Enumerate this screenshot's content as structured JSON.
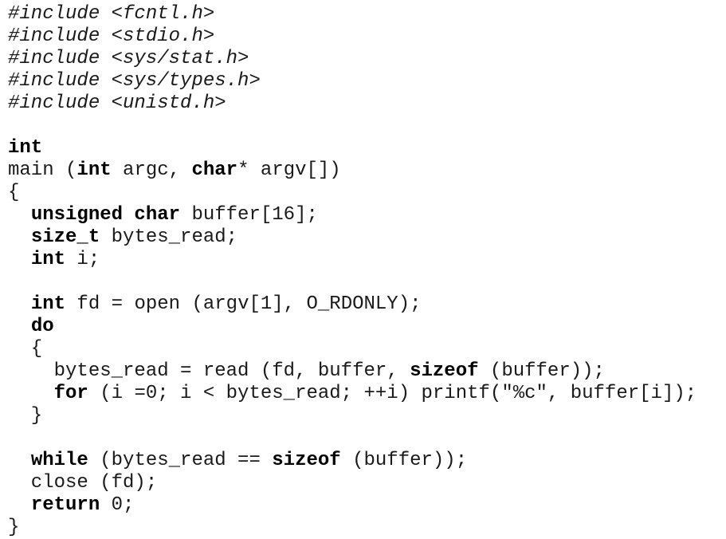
{
  "code_lines": [
    [
      {
        "t": "#include <fcntl.h>",
        "s": "it"
      }
    ],
    [
      {
        "t": "#include <stdio.h>",
        "s": "it"
      }
    ],
    [
      {
        "t": "#include <sys/stat.h>",
        "s": "it"
      }
    ],
    [
      {
        "t": "#include <sys/types.h>",
        "s": "it"
      }
    ],
    [
      {
        "t": "#include <unistd.h>",
        "s": "it"
      }
    ],
    [],
    [
      {
        "t": "int",
        "s": "kw"
      }
    ],
    [
      {
        "t": "main ("
      },
      {
        "t": "int",
        "s": "kw"
      },
      {
        "t": " argc, "
      },
      {
        "t": "char",
        "s": "kw"
      },
      {
        "t": "* argv[])"
      }
    ],
    [
      {
        "t": "{"
      }
    ],
    [
      {
        "t": "  "
      },
      {
        "t": "unsigned char",
        "s": "kw"
      },
      {
        "t": " buffer[16];"
      }
    ],
    [
      {
        "t": "  "
      },
      {
        "t": "size_t",
        "s": "kw"
      },
      {
        "t": " bytes_read;"
      }
    ],
    [
      {
        "t": "  "
      },
      {
        "t": "int",
        "s": "kw"
      },
      {
        "t": " i;"
      }
    ],
    [],
    [
      {
        "t": "  "
      },
      {
        "t": "int",
        "s": "kw"
      },
      {
        "t": " fd = open (argv[1], O_RDONLY);"
      }
    ],
    [
      {
        "t": "  "
      },
      {
        "t": "do",
        "s": "kw"
      }
    ],
    [
      {
        "t": "  {"
      }
    ],
    [
      {
        "t": "    bytes_read = read (fd, buffer, "
      },
      {
        "t": "sizeof",
        "s": "kw"
      },
      {
        "t": " (buffer));"
      }
    ],
    [
      {
        "t": "    "
      },
      {
        "t": "for",
        "s": "kw"
      },
      {
        "t": " (i =0; i < bytes_read; ++i) printf(\"%c\", buffer[i]);"
      }
    ],
    [
      {
        "t": "  }"
      }
    ],
    [],
    [
      {
        "t": "  "
      },
      {
        "t": "while",
        "s": "kw"
      },
      {
        "t": " (bytes_read == "
      },
      {
        "t": "sizeof",
        "s": "kw"
      },
      {
        "t": " (buffer));"
      }
    ],
    [
      {
        "t": "  close (fd);"
      }
    ],
    [
      {
        "t": "  "
      },
      {
        "t": "return",
        "s": "kw"
      },
      {
        "t": " 0;"
      }
    ],
    [
      {
        "t": "}"
      }
    ]
  ]
}
